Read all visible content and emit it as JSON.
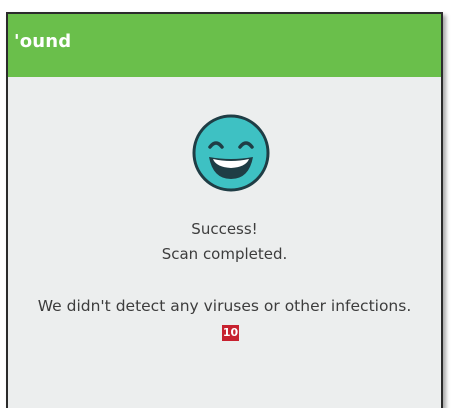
{
  "window": {
    "title": "'ound",
    "accent_color": "#6abf4b"
  },
  "status": {
    "icon": "smiley-face-icon",
    "heading": "Success!",
    "subheading": "Scan completed.",
    "message": "We didn't detect any viruses or other infections."
  },
  "annotation": {
    "badge_label": "10",
    "badge_color": "#c7212f"
  }
}
